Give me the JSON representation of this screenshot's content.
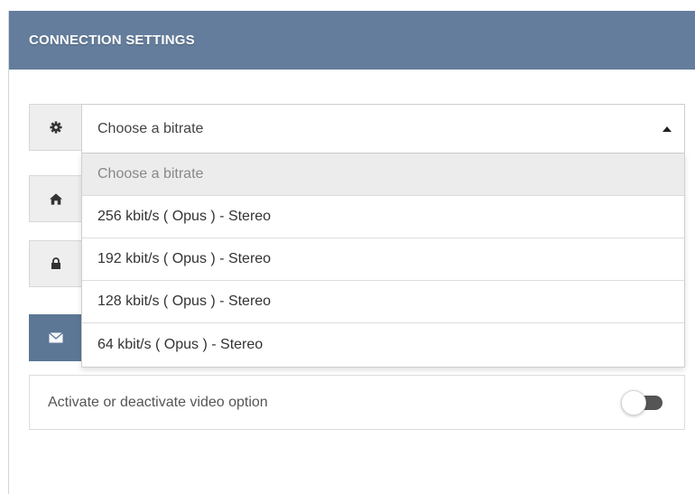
{
  "header": {
    "title": "CONNECTION SETTINGS"
  },
  "bitrate": {
    "icon": "gear-icon",
    "selected": "Choose a bitrate",
    "options": [
      "Choose a bitrate",
      "256 kbit/s ( Opus ) - Stereo",
      "192 kbit/s ( Opus ) - Stereo",
      "128 kbit/s ( Opus ) - Stereo",
      "64 kbit/s ( Opus ) - Stereo"
    ]
  },
  "hidden_fields": [
    {
      "icon": "home-icon"
    },
    {
      "icon": "lock-icon"
    },
    {
      "icon": "envelope-icon"
    }
  ],
  "video_toggle": {
    "label": "Activate or deactivate video option",
    "state": "off"
  },
  "colors": {
    "header_bg": "#647d9c",
    "accent_addon": "#5b7795",
    "toggle_track": "#555555"
  }
}
